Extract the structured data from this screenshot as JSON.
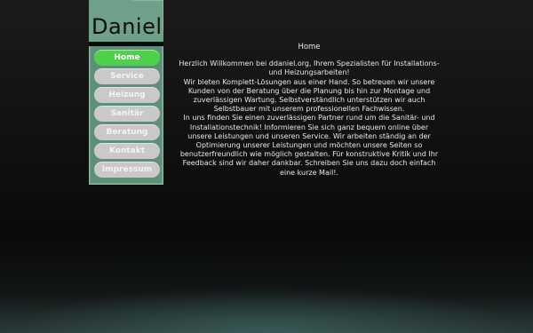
{
  "logo": {
    "text": "Daniel"
  },
  "nav": {
    "items": [
      {
        "label": "Home",
        "active": true
      },
      {
        "label": "Service"
      },
      {
        "label": "Heizung"
      },
      {
        "label": "Sanitär"
      },
      {
        "label": "Beratung"
      },
      {
        "label": "Kontakt"
      },
      {
        "label": "Impressum"
      }
    ]
  },
  "content": {
    "heading": "Home",
    "lines": [
      "Herzlich Willkommen bei ddaniel.org, Ihrem Spezialisten für Installations- und Heizungsarbeiten!",
      "Wir bieten Komplett-Lösungen aus einer Hand. So betreuen wir unsere Kunden von der Beratung über die Planung bis hin zur Montage und zuverlässigen Wartung. Selbstverständlich unterstützen wir auch Selbstbauer mit unserem professionellen Fachwissen.",
      "In uns finden Sie einen zuverlässigen Partner rund um die Sanitär- und Installationstechnik! Informieren Sie sich ganz bequem online über unsere Leistungen und unseren Service. Wir arbeiten ständig an der Optimierung unserer Leistungen und möchten unsere Seiten so benutzerfreundlich wie möglich gestalten. Für konstruktive Kritik und Ihr Feedback sind wir daher dankbar. Schreiben Sie uns dazu doch einfach eine kurze Mail!."
    ]
  },
  "colors": {
    "panel": "#6fa08a",
    "active_button": "#4ed14a",
    "button": "#c9c9c9",
    "text": "#e8e8e8"
  }
}
